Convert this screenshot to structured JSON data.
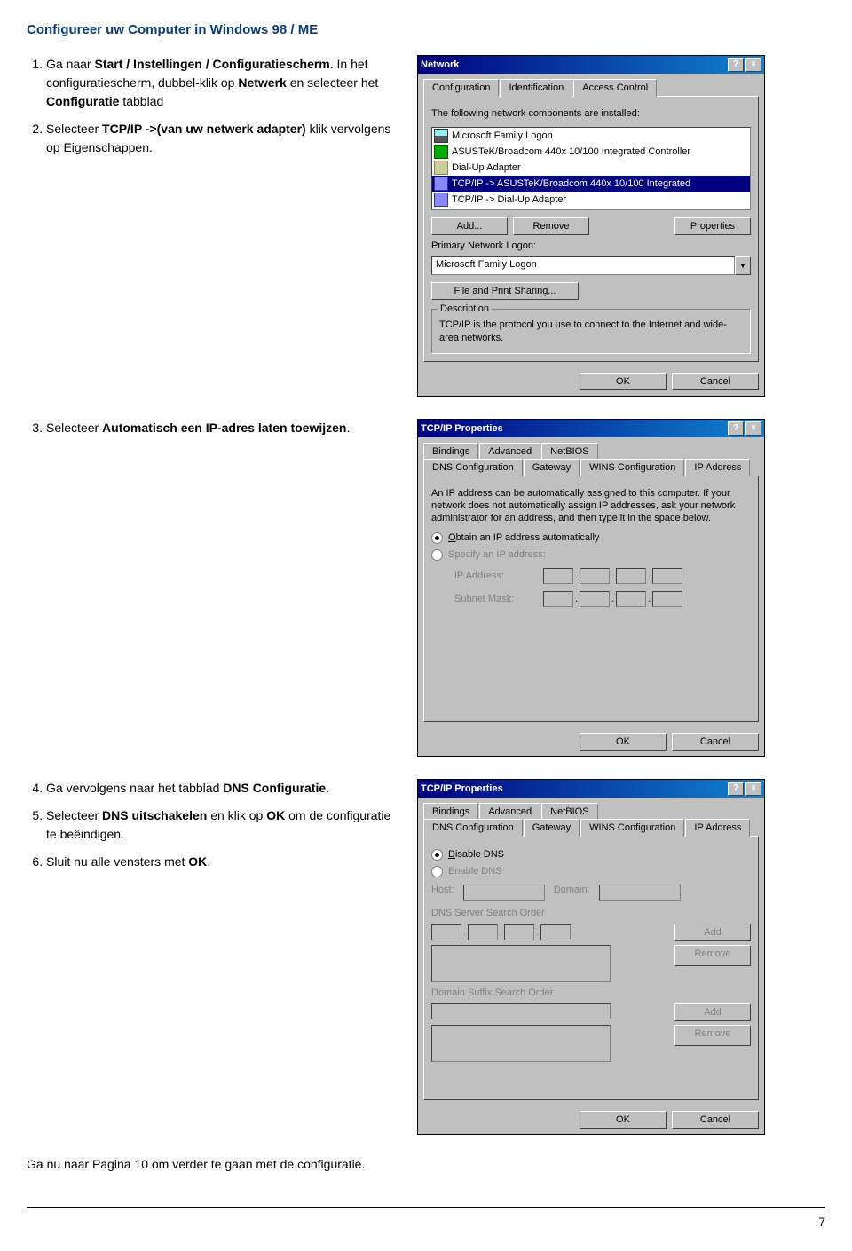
{
  "page": {
    "title": "Configureer uw Computer in Windows 98 / ME",
    "section1_items": [
      "Ga naar <b>Start / Instellingen / Configuratiescherm</b>. In het configuratiescherm, dubbel-klik op <b>Netwerk</b> en selecteer het <b>Configuratie</b> tabblad",
      "Selecteer <b>TCP/IP -&gt;(van uw netwerk adapter)</b> klik vervolgens op Eigenschappen."
    ],
    "section2_items": [
      "Selecteer <b>Automatisch een IP-adres laten toewijzen</b>."
    ],
    "section3_items": [
      "Ga vervolgens naar het tabblad <b>DNS Configuratie</b>.",
      "Selecteer <b>DNS uitschakelen</b> en klik op <b>OK</b> om de configuratie te beëindigen.",
      "Sluit nu alle vensters met <b>OK</b>."
    ],
    "footer": "Ga nu naar Pagina 10 om verder te gaan met de configuratie.",
    "pagenum": "7"
  },
  "dlg1": {
    "title": "Network",
    "tabs": [
      "Configuration",
      "Identification",
      "Access Control"
    ],
    "intro": "The following network components are installed:",
    "items": [
      "Microsoft Family Logon",
      "ASUSTeK/Broadcom 440x 10/100 Integrated Controller",
      "Dial-Up Adapter",
      "TCP/IP -> ASUSTeK/Broadcom 440x 10/100 Integrated",
      "TCP/IP -> Dial-Up Adapter"
    ],
    "add": "Add...",
    "remove": "Remove",
    "props": "Properties",
    "pnl": "Primary Network Logon:",
    "pnl_val": "Microsoft Family Logon",
    "fps": "File and Print Sharing...",
    "desc_lbl": "Description",
    "desc": "TCP/IP is the protocol you use to connect to the Internet and wide-area networks.",
    "ok": "OK",
    "cancel": "Cancel"
  },
  "dlg2": {
    "title": "TCP/IP Properties",
    "tabs_top": [
      "Bindings",
      "Advanced",
      "NetBIOS"
    ],
    "tabs_bot": [
      "DNS Configuration",
      "Gateway",
      "WINS Configuration",
      "IP Address"
    ],
    "intro": "An IP address can be automatically assigned to this computer. If your network does not automatically assign IP addresses, ask your network administrator for an address, and then type it in the space below.",
    "r1": "Obtain an IP address automatically",
    "r2": "Specify an IP address:",
    "ip": "IP Address:",
    "sm": "Subnet Mask:",
    "ok": "OK",
    "cancel": "Cancel"
  },
  "dlg3": {
    "title": "TCP/IP Properties",
    "tabs_top": [
      "Bindings",
      "Advanced",
      "NetBIOS"
    ],
    "tabs_bot": [
      "DNS Configuration",
      "Gateway",
      "WINS Configuration",
      "IP Address"
    ],
    "r1": "Disable DNS",
    "r2": "Enable DNS",
    "host": "Host:",
    "domain": "Domain:",
    "sso": "DNS Server Search Order",
    "dso": "Domain Suffix Search Order",
    "add": "Add",
    "remove": "Remove",
    "ok": "OK",
    "cancel": "Cancel"
  }
}
